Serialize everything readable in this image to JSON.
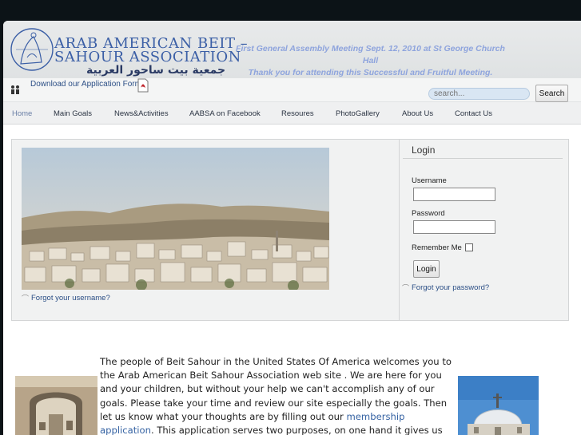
{
  "header": {
    "logo_line1": "ARAB AMERICAN BEIT –",
    "logo_line2": "SAHOUR ASSOCIATION",
    "logo_arabic": "جمعية بيت ساحور العربية",
    "announcement_line1": "First General Assembly Meeting Sept. 12, 2010 at St George Church Hall",
    "announcement_line2": "Thank you for attending this Successful and Fruitful Meeting."
  },
  "toolbar": {
    "download_label": "Download our Application Form",
    "search_placeholder": "search...",
    "search_button": "Search"
  },
  "nav": {
    "items": [
      {
        "label": "Home"
      },
      {
        "label": "Main Goals"
      },
      {
        "label": "News&Activities"
      },
      {
        "label": "AABSA on Facebook"
      },
      {
        "label": "Resoures"
      },
      {
        "label": "PhotoGallery"
      },
      {
        "label": "About Us"
      },
      {
        "label": "Contact Us"
      }
    ]
  },
  "banner": {
    "forgot_username": "Forgot your username?"
  },
  "login": {
    "title": "Login",
    "username_label": "Username",
    "password_label": "Password",
    "remember_label": "Remember Me",
    "button": "Login",
    "forgot_password": "Forgot your password?"
  },
  "welcome": {
    "text_before": "The people of Beit Sahour in the United States Of America welcomes you to the Arab American Beit Sahour Association web site . We are here for you and your children, but without your help we can't accomplish any of our goals. Please take your time and review our site especially the goals. Then let us know what your thoughts are by filling out our ",
    "link": "membership application",
    "text_after": ". This application serves two purposes, on one hand it gives us the ability to communicate with each other. On"
  },
  "colors": {
    "page_background": "#0c1317",
    "logo_blue": "#3b5fa6",
    "announcement": "#8ea4dd",
    "link": "#2c4f86",
    "nav_active": "#6a7fa6"
  }
}
